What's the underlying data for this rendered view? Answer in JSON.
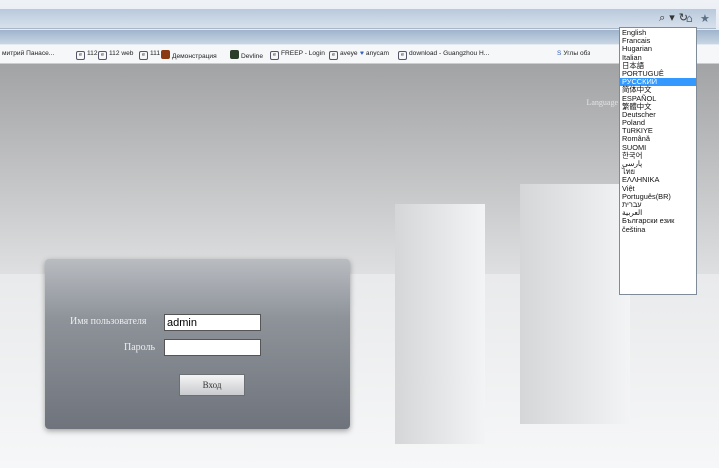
{
  "browser": {
    "address_icons": [
      "search-icon",
      "dropdown-arrow-icon",
      "refresh-icon"
    ],
    "favorites": [
      {
        "label": "митрий Панасе...",
        "icon": ""
      },
      {
        "label": "112",
        "icon": "page-icon"
      },
      {
        "label": "112 web",
        "icon": "page-icon"
      },
      {
        "label": "111",
        "icon": "page-icon"
      },
      {
        "label": "Демонстрация",
        "icon": "app-icon"
      },
      {
        "label": "Devline",
        "icon": "app-icon"
      },
      {
        "label": "FREEP - Login",
        "icon": "page-icon"
      },
      {
        "label": "aveye",
        "icon": "page-icon"
      },
      {
        "label": "anycam",
        "icon": "heart-icon"
      },
      {
        "label": "download - Guangzhou H...",
        "icon": "page-icon"
      },
      {
        "label": "Углы обз",
        "icon": "s-icon"
      }
    ]
  },
  "page": {
    "language_prompt": "Language"
  },
  "login": {
    "username_label": "Имя пользователя",
    "username_value": "admin",
    "password_label": "Пароль",
    "password_value": "",
    "submit_label": "Вход"
  },
  "language_menu": {
    "selected": "РУССКИЙ",
    "options": [
      "English",
      "Francais",
      "Hugarian",
      "Italian",
      "日本語",
      "PORTUGUÊ",
      "РУССКИЙ",
      "简体中文",
      "ESPAÑOL",
      "繁體中文",
      "Deutscher",
      "Poland",
      "TüRKIYE",
      "Română",
      "SUOMI",
      "한국어",
      "پارسی",
      "ไทย",
      "ΕΛΛΗΝΙΚΑ",
      "Việt",
      "Português(BR)",
      "עברית",
      "العربية",
      "Български език",
      "čeština"
    ]
  }
}
